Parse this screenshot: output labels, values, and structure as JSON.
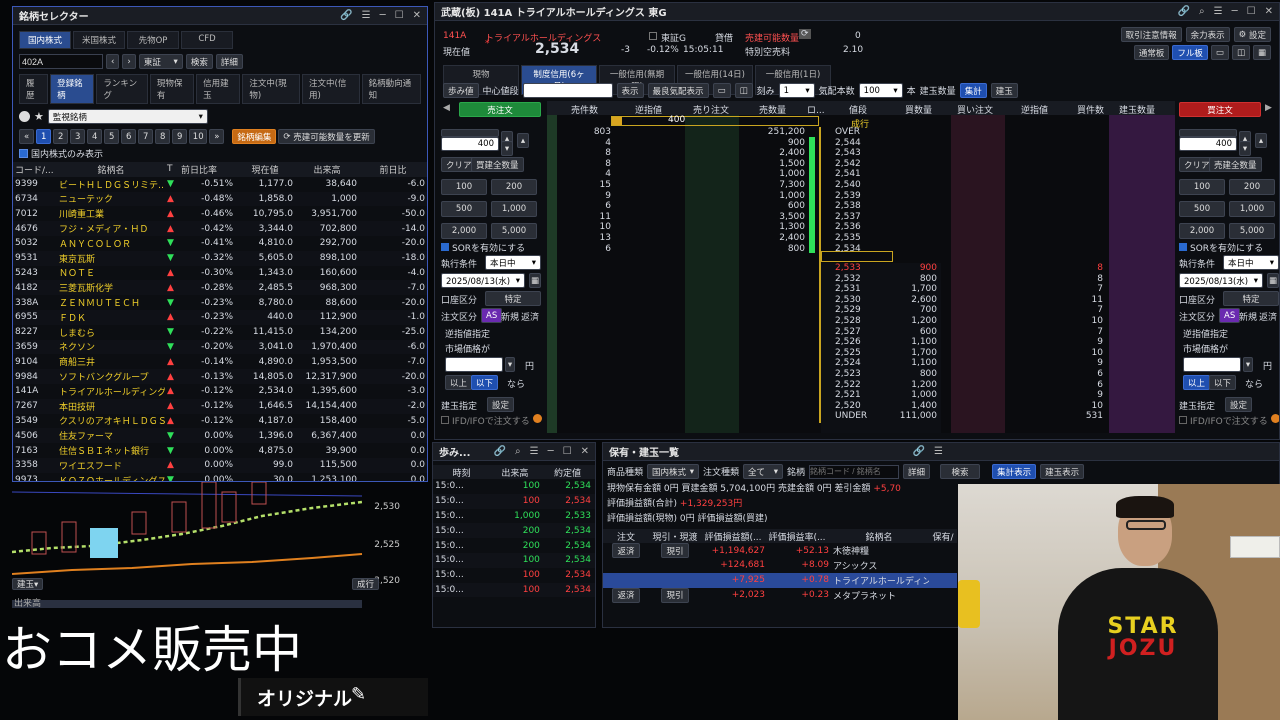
{
  "selector": {
    "title": "銘柄セレクター",
    "market_tabs": [
      "国内株式",
      "米国株式",
      "先物OP",
      "CFD"
    ],
    "code_input": "402A",
    "exchange": "東証",
    "search_btn": "検索",
    "detail_btn": "詳細",
    "category_tabs": [
      "履歴",
      "登録銘柄",
      "ランキング",
      "現物保有",
      "信用建玉",
      "注文中(現物)",
      "注文中(信用)",
      "銘柄動向通知"
    ],
    "watchlist_name": "監視銘柄",
    "pages": [
      "1",
      "2",
      "3",
      "4",
      "5",
      "6",
      "7",
      "8",
      "9",
      "10"
    ],
    "edit_btn": "銘柄編集",
    "update_btn": "売建可能数量を更新",
    "domestic_only": "国内株式のみ表示",
    "columns": [
      "コード/...",
      "銘柄名",
      "T",
      "前日比率",
      "現在値",
      "出来高",
      "前日比"
    ],
    "rows": [
      {
        "code": "9399",
        "name": "ビートＨＬＤＧＳリミテ…",
        "t": "▼",
        "pct": "-0.51%",
        "price": "1,177.0",
        "vol": "38,640",
        "chg": "-6.0",
        "dir": "dn"
      },
      {
        "code": "6734",
        "name": "ニューテック",
        "t": "▲",
        "pct": "-0.48%",
        "price": "1,858.0",
        "vol": "1,000",
        "chg": "-9.0",
        "dir": "up"
      },
      {
        "code": "7012",
        "name": "川崎重工業",
        "t": "▲",
        "pct": "-0.46%",
        "price": "10,795.0",
        "vol": "3,951,700",
        "chg": "-50.0",
        "dir": "up"
      },
      {
        "code": "4676",
        "name": "フジ・メディア・ＨＤ",
        "t": "▲",
        "pct": "-0.42%",
        "price": "3,344.0",
        "vol": "702,800",
        "chg": "-14.0",
        "dir": "up"
      },
      {
        "code": "5032",
        "name": "ＡＮＹＣＯＬＯＲ",
        "t": "▼",
        "pct": "-0.41%",
        "price": "4,810.0",
        "vol": "292,700",
        "chg": "-20.0",
        "dir": "dn"
      },
      {
        "code": "9531",
        "name": "東京瓦斯",
        "t": "▼",
        "pct": "-0.32%",
        "price": "5,605.0",
        "vol": "898,100",
        "chg": "-18.0",
        "dir": "dn"
      },
      {
        "code": "5243",
        "name": "ＮＯＴＥ",
        "t": "▲",
        "pct": "-0.30%",
        "price": "1,343.0",
        "vol": "160,600",
        "chg": "-4.0",
        "dir": "up"
      },
      {
        "code": "4182",
        "name": "三菱瓦斯化学",
        "t": "▲",
        "pct": "-0.28%",
        "price": "2,485.5",
        "vol": "968,300",
        "chg": "-7.0",
        "dir": "up"
      },
      {
        "code": "338A",
        "name": "ＺＥＮＭＵＴＥＣＨ",
        "t": "▼",
        "pct": "-0.23%",
        "price": "8,780.0",
        "vol": "88,600",
        "chg": "-20.0",
        "dir": "dn"
      },
      {
        "code": "6955",
        "name": "ＦＤＫ",
        "t": "▲",
        "pct": "-0.23%",
        "price": "440.0",
        "vol": "112,900",
        "chg": "-1.0",
        "dir": "up"
      },
      {
        "code": "8227",
        "name": "しまむら",
        "t": "▼",
        "pct": "-0.22%",
        "price": "11,415.0",
        "vol": "134,200",
        "chg": "-25.0",
        "dir": "dn"
      },
      {
        "code": "3659",
        "name": "ネクソン",
        "t": "▼",
        "pct": "-0.20%",
        "price": "3,041.0",
        "vol": "1,970,400",
        "chg": "-6.0",
        "dir": "dn"
      },
      {
        "code": "9104",
        "name": "商船三井",
        "t": "▲",
        "pct": "-0.14%",
        "price": "4,890.0",
        "vol": "1,953,500",
        "chg": "-7.0",
        "dir": "up"
      },
      {
        "code": "9984",
        "name": "ソフトバンクグループ",
        "t": "▲",
        "pct": "-0.13%",
        "price": "14,805.0",
        "vol": "12,317,900",
        "chg": "-20.0",
        "dir": "up"
      },
      {
        "code": "141A",
        "name": "トライアルホールディングス",
        "t": "▲",
        "pct": "-0.12%",
        "price": "2,534.0",
        "vol": "1,395,600",
        "chg": "-3.0",
        "dir": "up"
      },
      {
        "code": "7267",
        "name": "本田技研",
        "t": "▲",
        "pct": "-0.12%",
        "price": "1,646.5",
        "vol": "14,154,400",
        "chg": "-2.0",
        "dir": "up"
      },
      {
        "code": "3549",
        "name": "クスリのアオキＨＬＤＧＳ",
        "t": "▲",
        "pct": "-0.12%",
        "price": "4,187.0",
        "vol": "158,400",
        "chg": "-5.0",
        "dir": "up"
      },
      {
        "code": "4506",
        "name": "住友ファーマ",
        "t": "▼",
        "pct": "0.00%",
        "price": "1,396.0",
        "vol": "6,367,400",
        "chg": "0.0",
        "dir": "dn"
      },
      {
        "code": "7163",
        "name": "住信ＳＢＩネット銀行",
        "t": "▼",
        "pct": "0.00%",
        "price": "4,875.0",
        "vol": "39,900",
        "chg": "0.0",
        "dir": "dn"
      },
      {
        "code": "3358",
        "name": "ワイエスフード",
        "t": "▲",
        "pct": "0.00%",
        "price": "99.0",
        "vol": "115,500",
        "chg": "0.0",
        "dir": "up"
      },
      {
        "code": "9973",
        "name": "ＫＯＺＯホールディングス",
        "t": "▼",
        "pct": "0.00%",
        "price": "30.0",
        "vol": "1,253,100",
        "chg": "0.0",
        "dir": "dn"
      }
    ]
  },
  "chart": {
    "y_labels": [
      "2,530",
      "2,525",
      "2,520"
    ],
    "bottom_left": "建玉▾",
    "bottom_right": "成行",
    "volume_label": "出来高"
  },
  "board": {
    "title": "武蔵(板) 141A トライアルホールディングス 東G",
    "code": "141A",
    "name": "トライアルホールディングス",
    "market": "東証G",
    "current_label": "現在値",
    "price": "2,534",
    "change": "-3",
    "change_pct": "-0.12%",
    "time": "15:05:11",
    "lending_label": "貸借",
    "sellable_label": "売建可能数量",
    "sellable_value": "0",
    "special_label": "特別空売料",
    "special_value": "2.10",
    "top_buttons": [
      "取引注意情報",
      "余力表示",
      "設定"
    ],
    "view_buttons": [
      "通常板",
      "フル板"
    ],
    "trade_tabs": [
      "現物",
      "制度信用(6ヶ月)",
      "一般信用(無期限)",
      "一般信用(14日)",
      "一般信用(1日)"
    ],
    "toolbar": {
      "walk": "歩み値",
      "center": "中心値段",
      "show": "表示",
      "best": "最良気配表示",
      "step_label": "刻み",
      "step": "1",
      "quote_label": "気配本数",
      "quote": "100",
      "unit": "本",
      "pos": "建玉数量",
      "agg": "集計",
      "pos2": "建玉"
    },
    "sell_btn": "売注文",
    "buy_btn": "買注文",
    "headers": [
      "売件数",
      "逆指値",
      "売り注文",
      "売数量",
      "ロ...",
      "値段",
      "買数量",
      "買い注文",
      "逆指値",
      "買件数",
      "建玉数量"
    ],
    "over_label": "OVER",
    "market_label": "成行",
    "under_label": "UNDER",
    "cursor_qty": "400",
    "ask_rows": [
      {
        "cnt": "803",
        "qty": "251,200",
        "price": "OVER"
      },
      {
        "cnt": "4",
        "qty": "900",
        "price": "2,544"
      },
      {
        "cnt": "8",
        "qty": "2,400",
        "price": "2,543"
      },
      {
        "cnt": "8",
        "qty": "1,500",
        "price": "2,542"
      },
      {
        "cnt": "4",
        "qty": "1,000",
        "price": "2,541"
      },
      {
        "cnt": "15",
        "qty": "7,300",
        "price": "2,540"
      },
      {
        "cnt": "9",
        "qty": "1,000",
        "price": "2,539"
      },
      {
        "cnt": "6",
        "qty": "600",
        "price": "2,538"
      },
      {
        "cnt": "11",
        "qty": "3,500",
        "price": "2,537"
      },
      {
        "cnt": "10",
        "qty": "1,300",
        "price": "2,536"
      },
      {
        "cnt": "13",
        "qty": "2,400",
        "price": "2,535"
      },
      {
        "cnt": "6",
        "qty": "800",
        "price": "2,534"
      }
    ],
    "bid_rows": [
      {
        "price": "2,533",
        "qty": "900",
        "cnt": "8"
      },
      {
        "price": "2,532",
        "qty": "800",
        "cnt": "8"
      },
      {
        "price": "2,531",
        "qty": "1,700",
        "cnt": "7"
      },
      {
        "price": "2,530",
        "qty": "2,600",
        "cnt": "11"
      },
      {
        "price": "2,529",
        "qty": "700",
        "cnt": "7"
      },
      {
        "price": "2,528",
        "qty": "1,200",
        "cnt": "10"
      },
      {
        "price": "2,527",
        "qty": "600",
        "cnt": "7"
      },
      {
        "price": "2,526",
        "qty": "1,100",
        "cnt": "9"
      },
      {
        "price": "2,525",
        "qty": "1,700",
        "cnt": "10"
      },
      {
        "price": "2,524",
        "qty": "1,100",
        "cnt": "9"
      },
      {
        "price": "2,523",
        "qty": "800",
        "cnt": "6"
      },
      {
        "price": "2,522",
        "qty": "1,200",
        "cnt": "6"
      },
      {
        "price": "2,521",
        "qty": "1,000",
        "cnt": "9"
      },
      {
        "price": "2,520",
        "qty": "1,400",
        "cnt": "10"
      },
      {
        "price": "UNDER",
        "qty": "111,000",
        "cnt": "531"
      }
    ],
    "order_panel": {
      "qty": "400",
      "clear": "クリア",
      "all_sell": "買建全数量",
      "all_buy": "売建全数量",
      "qty_buttons": [
        "100",
        "200",
        "500",
        "1,000",
        "2,000",
        "5,000"
      ],
      "sor": "SORを有効にする",
      "cond_label": "執行条件",
      "cond": "本日中",
      "date": "2025/08/13(水)",
      "account_label": "口座区分",
      "account": "特定",
      "order_label": "注文区分",
      "as": "AS",
      "new": "新規",
      "close": "返済",
      "stop_label": "逆指値指定",
      "market_price": "市場価格が",
      "yen": "円",
      "above": "以上",
      "below": "以下",
      "then": "なら",
      "pos_label": "建玉指定",
      "setting": "設定",
      "ifd": "IFD/IFOで注文する"
    }
  },
  "walk": {
    "title": "歩み...",
    "columns": [
      "時刻",
      "出来高",
      "約定値"
    ],
    "rows": [
      {
        "t": "15:0...",
        "v": "100",
        "p": "2,534",
        "c": "dn"
      },
      {
        "t": "15:0...",
        "v": "100",
        "p": "2,534",
        "c": "up"
      },
      {
        "t": "15:0...",
        "v": "1,000",
        "p": "2,533",
        "c": "dn"
      },
      {
        "t": "15:0...",
        "v": "200",
        "p": "2,534",
        "c": "dn"
      },
      {
        "t": "15:0...",
        "v": "200",
        "p": "2,534",
        "c": "dn"
      },
      {
        "t": "15:0...",
        "v": "100",
        "p": "2,534",
        "c": "dn"
      },
      {
        "t": "15:0...",
        "v": "100",
        "p": "2,534",
        "c": "up"
      },
      {
        "t": "15:0...",
        "v": "100",
        "p": "2,534",
        "c": "up"
      }
    ]
  },
  "holdings": {
    "title": "保有・建玉一覧",
    "type_label": "商品種類",
    "type": "国内株式",
    "order_type_label": "注文種類",
    "order_type": "全て",
    "brand_label": "銘柄",
    "brand_placeholder": "銘柄コード / 銘柄名",
    "detail": "詳細",
    "search": "検索",
    "agg_btn": "集計表示",
    "pos_btn": "建玉表示",
    "summary1": "現物保有金額 0円   買建金額 5,704,100円   売建金額 0円   差引金額",
    "summary1_val": "+5,70",
    "summary2": "評価損益額(合計)",
    "summary2_val": "+1,329,253円",
    "summary3": "評価損益額(現物) 0円   評価損益額(買建)",
    "columns": [
      "注文",
      "現引・現渡",
      "評価損益額(...",
      "評価損益率(...",
      "銘柄名",
      "保有/"
    ],
    "rows": [
      {
        "a": "返済",
        "b": "現引",
        "pl": "+1,194,627",
        "pct": "+52.13",
        "name": "木徳神糧",
        "sel": false
      },
      {
        "a": "",
        "b": "",
        "pl": "+124,681",
        "pct": "+8.09",
        "name": "アシックス",
        "sel": false
      },
      {
        "a": "",
        "b": "",
        "pl": "+7,925",
        "pct": "+0.78",
        "name": "トライアルホールディン...",
        "sel": true
      },
      {
        "a": "返済",
        "b": "現引",
        "pl": "+2,023",
        "pct": "+0.23",
        "name": "メタプラネット",
        "sel": false
      }
    ]
  },
  "overlay": {
    "rice": "おコメ販売中",
    "original": "オリジナル"
  },
  "shirt": {
    "line1": "STAR",
    "line2": "JOZU"
  }
}
